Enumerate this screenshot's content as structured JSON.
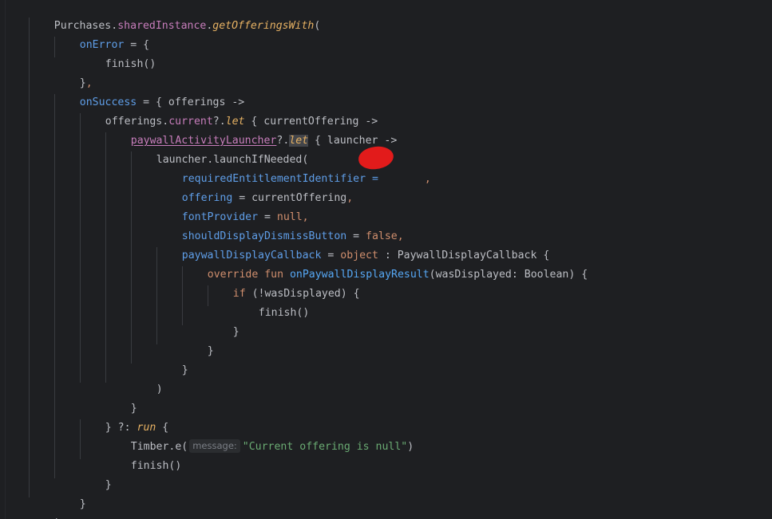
{
  "code": {
    "l1": {
      "a": "Purchases",
      "b": ".",
      "c": "sharedInstance",
      "d": ".",
      "e": "getOfferingsWith",
      "f": "("
    },
    "l2": {
      "a": "onError",
      "b": " = {"
    },
    "l3": {
      "a": "finish()"
    },
    "l4": {
      "a": "}",
      "b": ","
    },
    "l5": {
      "a": "onSuccess",
      "b": " = { offerings ->"
    },
    "l6": {
      "a": "offerings",
      "b": ".",
      "c": "current",
      "d": "?.",
      "e": "let",
      "f": " { currentOffering ->"
    },
    "l7": {
      "a": "paywallActivityLauncher",
      "b": "?.",
      "c": "let",
      "d": " { launcher ->"
    },
    "l8": {
      "a": "launcher.launchIfNeeded("
    },
    "l9": {
      "a": "requiredEntitlementIdentifier",
      "b": " = ",
      "c": ","
    },
    "l10": {
      "a": "offering",
      "b": " = currentOffering",
      "c": ","
    },
    "l11": {
      "a": "fontProvider",
      "b": " = ",
      "c": "null",
      "d": ","
    },
    "l12": {
      "a": "shouldDisplayDismissButton",
      "b": " = ",
      "c": "false",
      "d": ","
    },
    "l13": {
      "a": "paywallDisplayCallback",
      "b": " = ",
      "c": "object",
      "d": " : PaywallDisplayCallback {"
    },
    "l14": {
      "a": "override fun ",
      "b": "onPaywallDisplayResult",
      "c": "(wasDisplayed: Boolean) {"
    },
    "l15": {
      "a": "if",
      "b": " (!wasDisplayed) {"
    },
    "l16": {
      "a": "finish()"
    },
    "l17": {
      "a": "}"
    },
    "l18": {
      "a": "}"
    },
    "l19": {
      "a": "}"
    },
    "l20": {
      "a": ")"
    },
    "l21": {
      "a": "}"
    },
    "l22": {
      "a": "} ",
      "b": "?:",
      "c": " ",
      "d": "run",
      "e": " {"
    },
    "l23": {
      "a": "Timber.e(",
      "hint": "message:",
      "b": "\"Current offering is null\"",
      "c": ")"
    },
    "l24": {
      "a": "finish()"
    },
    "l25": {
      "a": "}"
    },
    "l26": {
      "a": "}"
    },
    "l27": {
      "a": ")"
    }
  },
  "colors": {
    "background": "#1e1f22",
    "keyword": "#cf8e6d",
    "function": "#56a8f5",
    "string": "#6aab73",
    "property": "#c77dbb",
    "redaction": "#e21b1b"
  }
}
